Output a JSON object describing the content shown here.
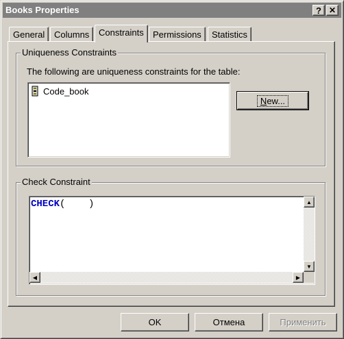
{
  "window": {
    "title": "Books Properties",
    "help_button": "?",
    "close_button": "✕"
  },
  "tabs": [
    {
      "label": "General",
      "active": false
    },
    {
      "label": "Columns",
      "active": false
    },
    {
      "label": "Constraints",
      "active": true
    },
    {
      "label": "Permissions",
      "active": false
    },
    {
      "label": "Statistics",
      "active": false
    }
  ],
  "uniqueness": {
    "group_label": "Uniqueness Constraints",
    "description": "The following are uniqueness constraints for the table:",
    "items": [
      {
        "label": "Code_book",
        "icon": "key-index-icon"
      }
    ],
    "new_button": {
      "mnemonic": "N",
      "rest": "ew..."
    }
  },
  "check": {
    "group_label": "Check Constraint",
    "keyword": "CHECK",
    "rest": "(    )",
    "keyword_color": "#0000c0"
  },
  "footer": {
    "ok_label": "OK",
    "cancel_label": "Отмена",
    "apply_label": "Применить",
    "apply_enabled": false
  },
  "colors": {
    "face": "#d4d0c8",
    "title_inactive": "#808080",
    "disabled_text": "#808080"
  }
}
